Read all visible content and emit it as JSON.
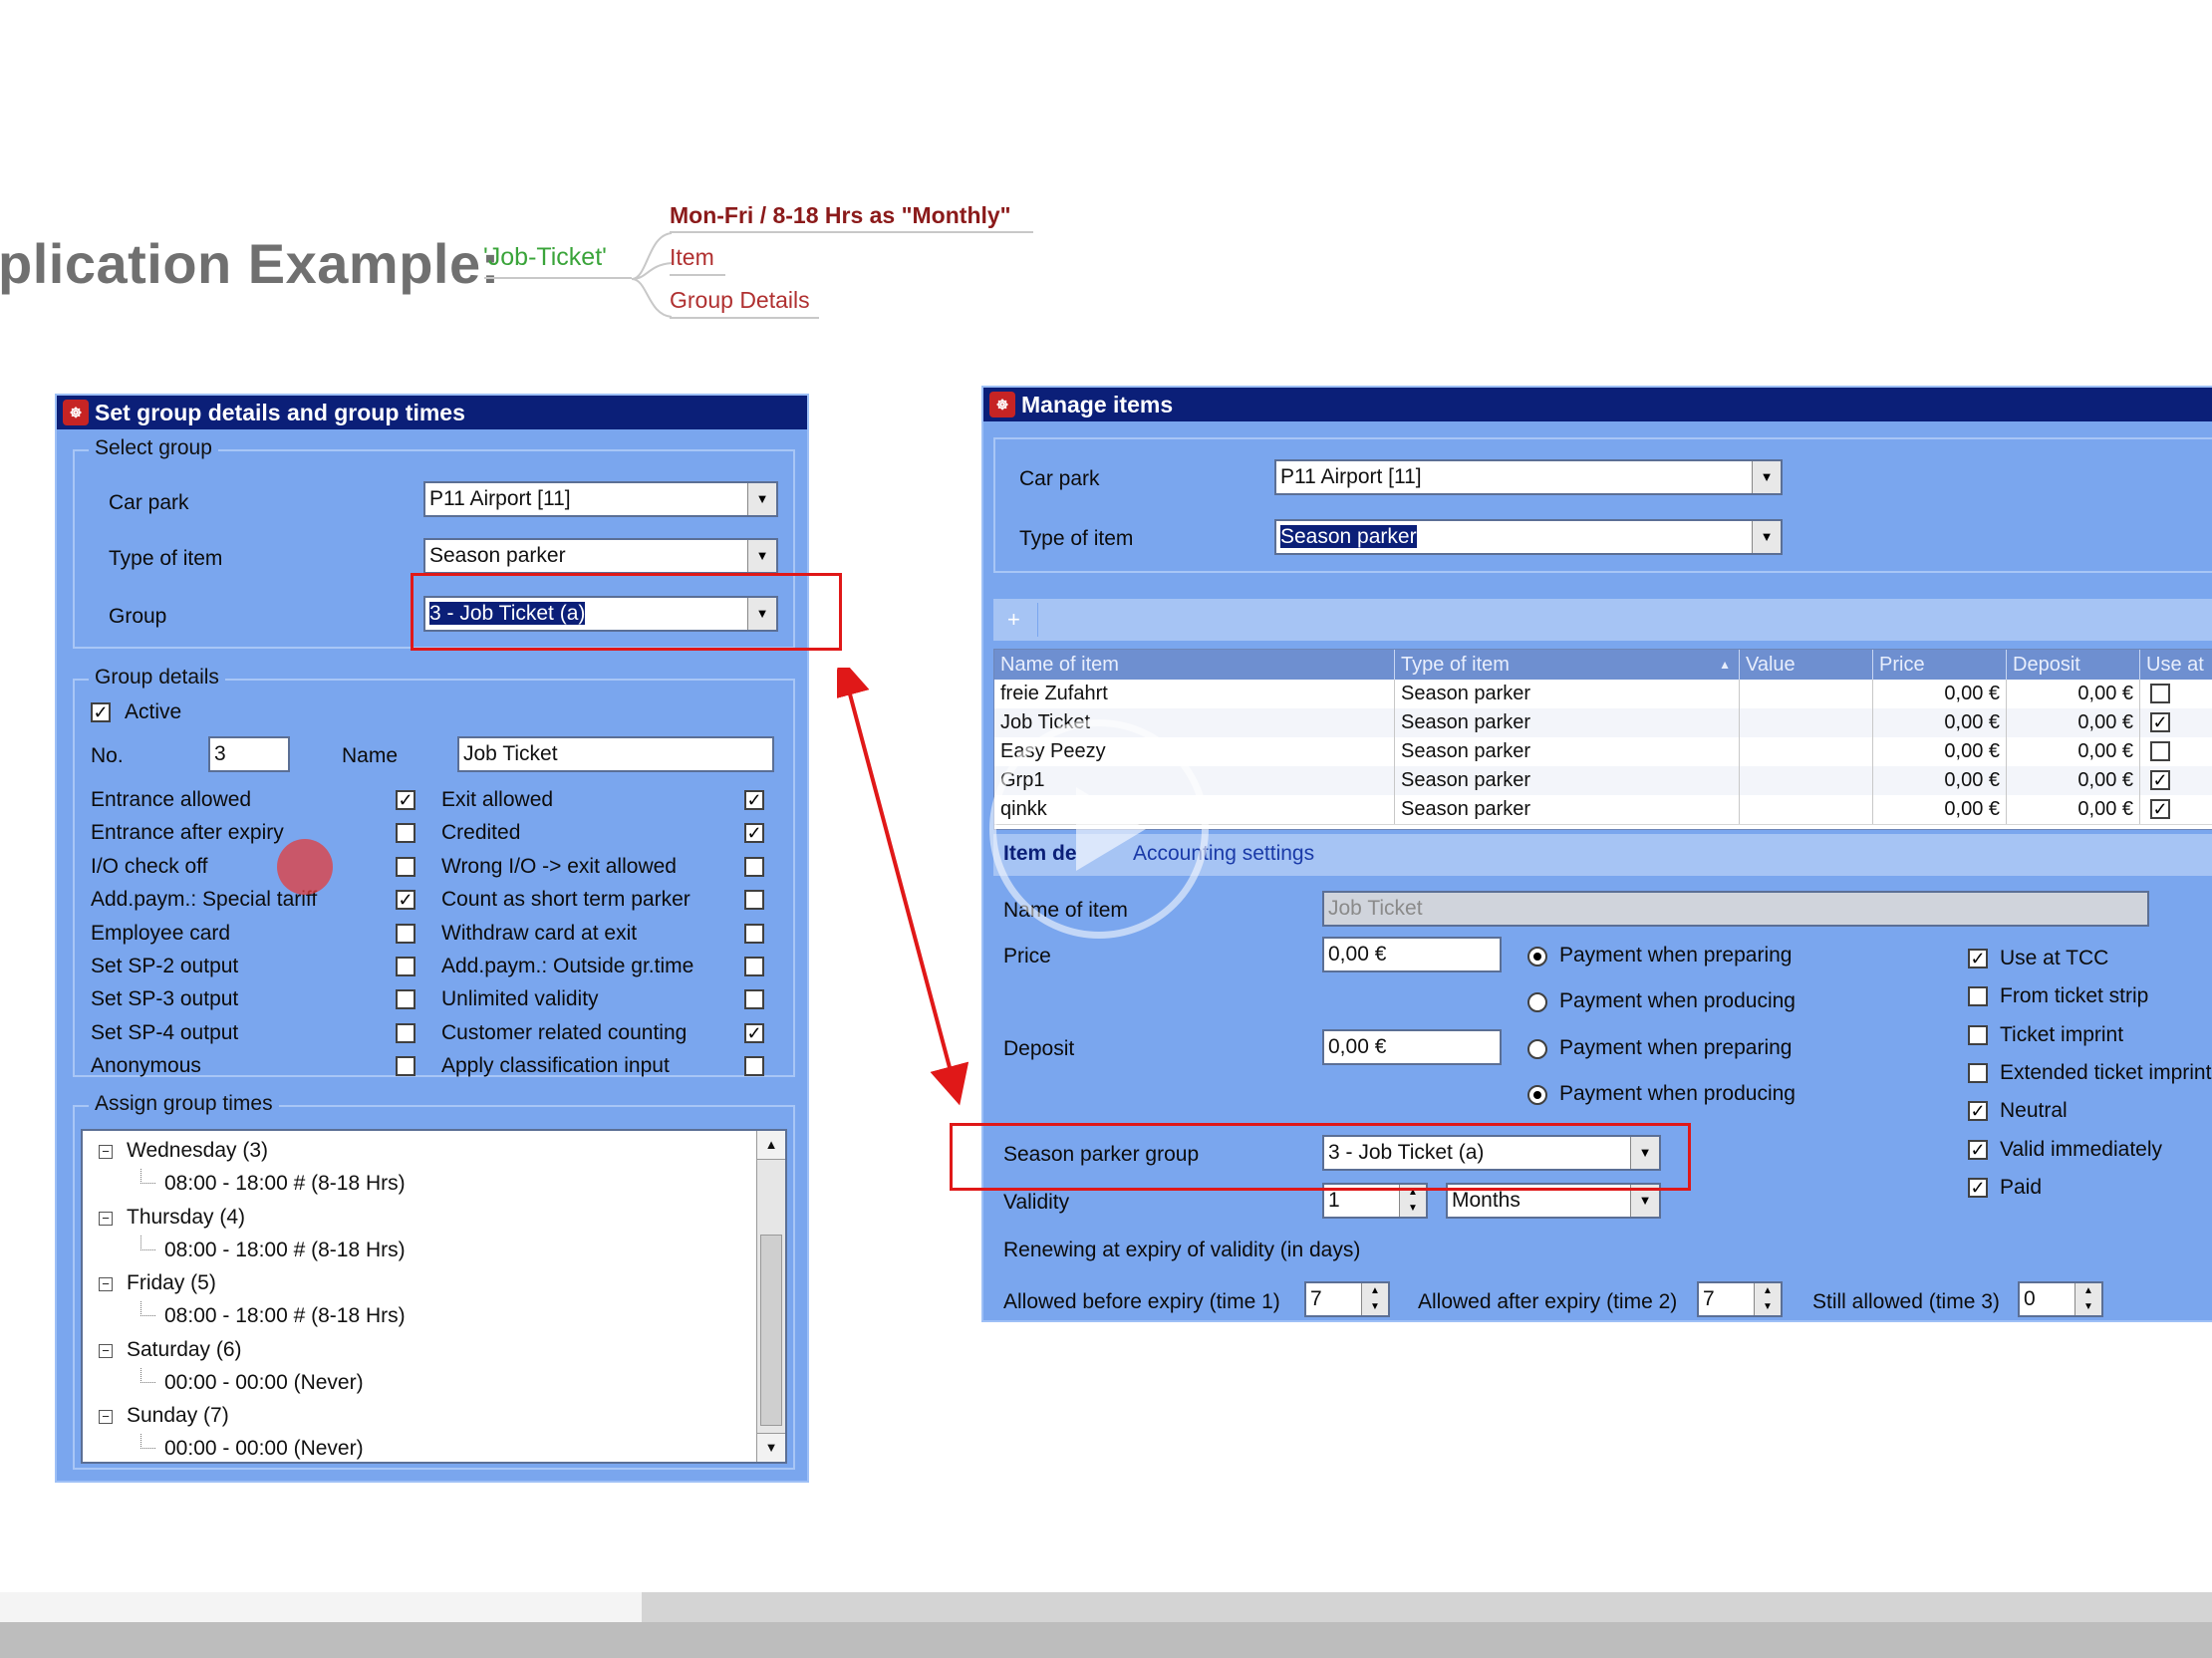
{
  "slide": {
    "title": "plication Example:",
    "mindmap": {
      "root": "'Job-Ticket'",
      "branches": [
        "Mon-Fri / 8-18 Hrs as \"Monthly\"",
        "Item",
        "Group Details"
      ]
    }
  },
  "left_window": {
    "title": "Set group details and group times",
    "select_group": {
      "legend": "Select group",
      "car_park_label": "Car park",
      "car_park_value": "P11 Airport [11]",
      "type_label": "Type of item",
      "type_value": "Season parker",
      "group_label": "Group",
      "group_value": "3 - Job Ticket (a)"
    },
    "group_details": {
      "legend": "Group details",
      "active_label": "Active",
      "active_checked": true,
      "no_label": "No.",
      "no_value": "3",
      "name_label": "Name",
      "name_value": "Job Ticket",
      "options": [
        {
          "label": "Entrance allowed",
          "checked": true
        },
        {
          "label": "Entrance after expiry",
          "checked": false
        },
        {
          "label": "I/O check off",
          "checked": false
        },
        {
          "label": "Add.paym.: Special tariff",
          "checked": true
        },
        {
          "label": "Employee card",
          "checked": false
        },
        {
          "label": "Set SP-2 output",
          "checked": false
        },
        {
          "label": "Set SP-3 output",
          "checked": false
        },
        {
          "label": "Set SP-4 output",
          "checked": false
        },
        {
          "label": "Anonymous",
          "checked": false
        },
        {
          "label": "Exit allowed",
          "checked": true
        },
        {
          "label": "Credited",
          "checked": true
        },
        {
          "label": "Wrong I/O -> exit allowed",
          "checked": false
        },
        {
          "label": "Count as short term parker",
          "checked": false
        },
        {
          "label": "Withdraw card at exit",
          "checked": false
        },
        {
          "label": "Add.paym.: Outside gr.time",
          "checked": false
        },
        {
          "label": "Unlimited validity",
          "checked": false
        },
        {
          "label": "Customer related counting",
          "checked": true
        },
        {
          "label": "Apply classification input",
          "checked": false
        }
      ]
    },
    "assign_times": {
      "legend": "Assign group times",
      "tree": [
        {
          "day": "Wednesday (3)",
          "time": "08:00 - 18:00 # (8-18 Hrs)"
        },
        {
          "day": "Thursday (4)",
          "time": "08:00 - 18:00 # (8-18 Hrs)"
        },
        {
          "day": "Friday (5)",
          "time": "08:00 - 18:00 # (8-18 Hrs)"
        },
        {
          "day": "Saturday (6)",
          "time": "00:00 - 00:00 (Never)"
        },
        {
          "day": "Sunday (7)",
          "time": "00:00 - 00:00 (Never)"
        }
      ]
    }
  },
  "right_window": {
    "title": "Manage items",
    "car_park_label": "Car park",
    "car_park_value": "P11 Airport [11]",
    "type_label": "Type of item",
    "type_value": "Season parker",
    "add_button": "+",
    "grid": {
      "columns": [
        "Name of item",
        "Type of item",
        "Value",
        "Price",
        "Deposit",
        "Use at"
      ],
      "rows": [
        {
          "name": "freie Zufahrt",
          "type": "Season parker",
          "value": "",
          "price": "0,00 €",
          "deposit": "0,00 €",
          "use": false
        },
        {
          "name": "Job Ticket",
          "type": "Season parker",
          "value": "",
          "price": "0,00 €",
          "deposit": "0,00 €",
          "use": true
        },
        {
          "name": "Easy Peezy",
          "type": "Season parker",
          "value": "",
          "price": "0,00 €",
          "deposit": "0,00 €",
          "use": false
        },
        {
          "name": "Grp1",
          "type": "Season parker",
          "value": "",
          "price": "0,00 €",
          "deposit": "0,00 €",
          "use": true
        },
        {
          "name": "qinkk",
          "type": "Season parker",
          "value": "",
          "price": "0,00 €",
          "deposit": "0,00 €",
          "use": true
        }
      ]
    },
    "tabs": [
      "Item de",
      "Accounting settings"
    ],
    "detail": {
      "name_label": "Name of item",
      "name_value": "Job Ticket",
      "price_label": "Price",
      "price_value": "0,00 €",
      "deposit_label": "Deposit",
      "deposit_value": "0,00 €",
      "payment_options": [
        {
          "label": "Payment when preparing",
          "selected": true
        },
        {
          "label": "Payment when producing",
          "selected": false
        },
        {
          "label": "Payment when preparing",
          "selected": false
        },
        {
          "label": "Payment when producing",
          "selected": true
        }
      ],
      "flags": [
        {
          "label": "Use at TCC",
          "checked": true
        },
        {
          "label": "From ticket strip",
          "checked": false
        },
        {
          "label": "Ticket imprint",
          "checked": false
        },
        {
          "label": "Extended ticket imprint",
          "checked": false
        },
        {
          "label": "Neutral",
          "checked": true
        },
        {
          "label": "Valid immediately",
          "checked": true
        },
        {
          "label": "Paid",
          "checked": true
        }
      ],
      "season_group_label": "Season parker group",
      "season_group_value": "3 - Job Ticket (a)",
      "validity_label": "Validity",
      "validity_value": "1",
      "validity_unit": "Months",
      "renewing_label": "Renewing at expiry of validity (in days)",
      "before_label": "Allowed before expiry (time 1)",
      "before_value": "7",
      "after_label": "Allowed after expiry (time 2)",
      "after_value": "7",
      "still_label": "Still allowed (time 3)",
      "still_value": "0"
    }
  },
  "video": {
    "progress_fraction": 0.29
  },
  "colors": {
    "window_bg": "#7aa6ee",
    "titlebar": "#0b1f78",
    "highlight": "#e01818"
  }
}
